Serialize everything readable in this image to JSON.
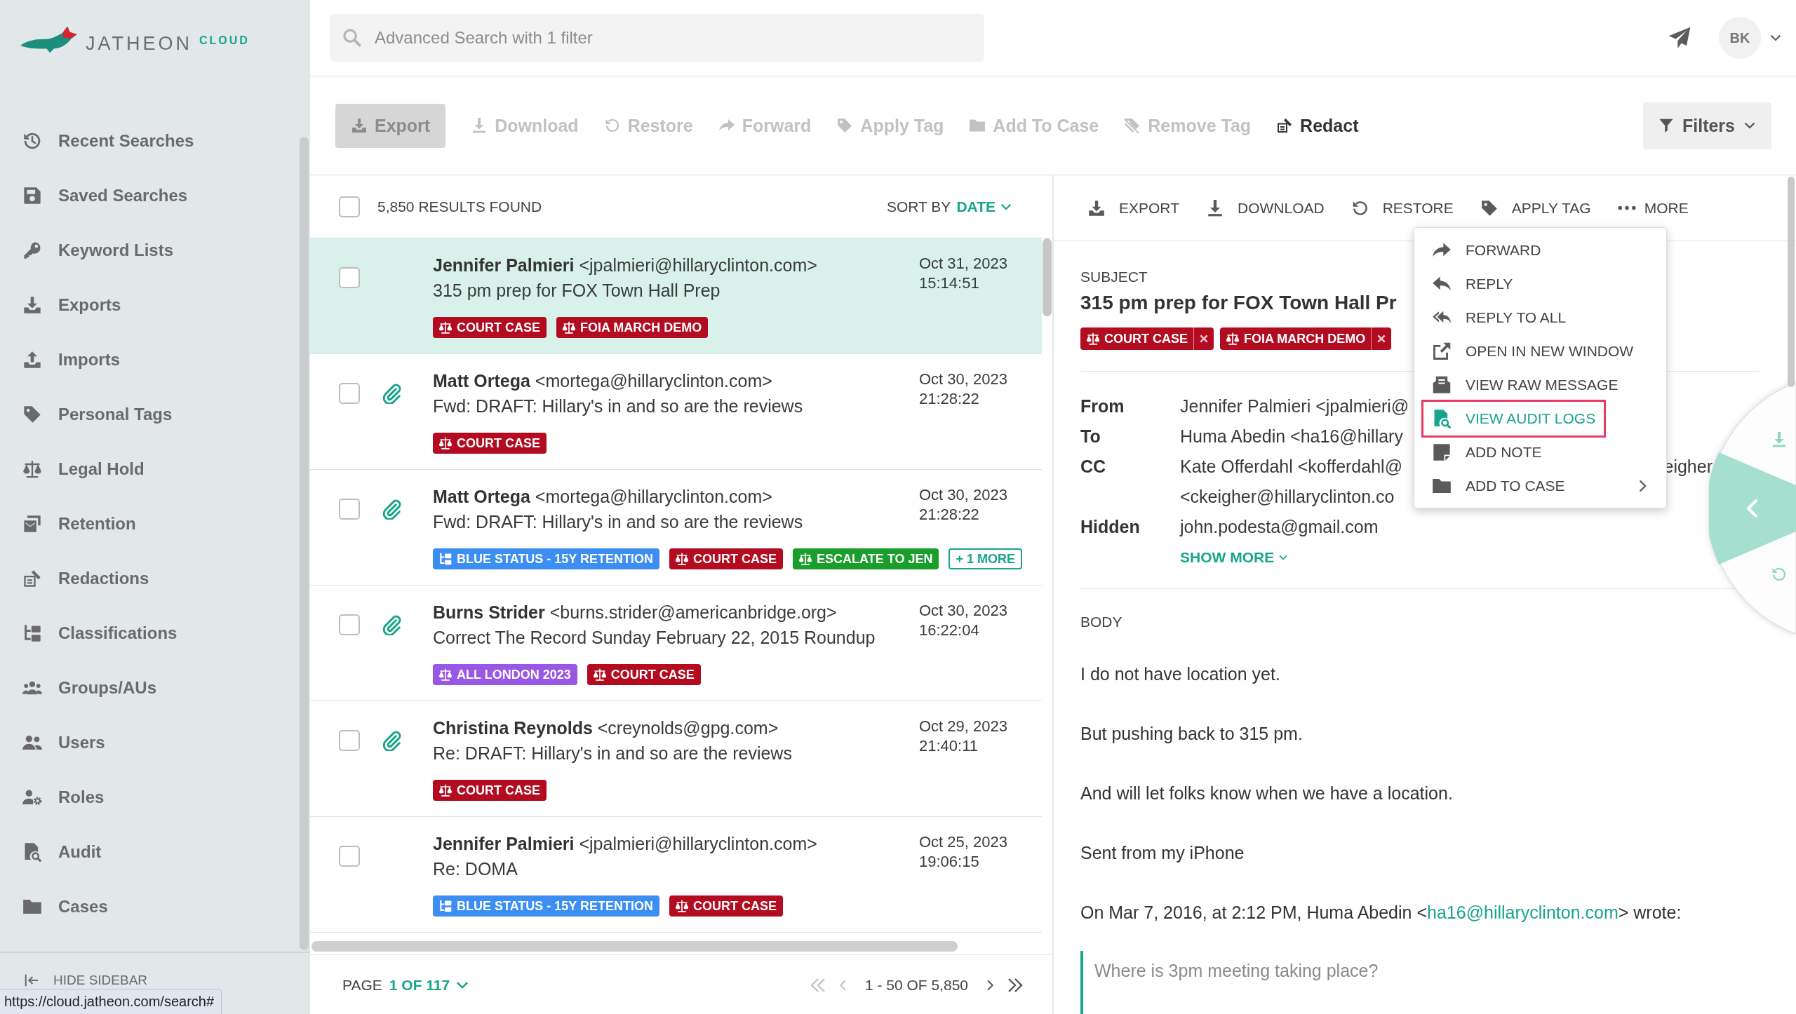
{
  "logo": {
    "name": "JATHEON",
    "suffix": "CLOUD"
  },
  "sidebar": {
    "items": [
      {
        "label": "Recent Searches"
      },
      {
        "label": "Saved Searches"
      },
      {
        "label": "Keyword Lists"
      },
      {
        "label": "Exports"
      },
      {
        "label": "Imports"
      },
      {
        "label": "Personal Tags"
      },
      {
        "label": "Legal Hold"
      },
      {
        "label": "Retention"
      },
      {
        "label": "Redactions"
      },
      {
        "label": "Classifications"
      },
      {
        "label": "Groups/AUs"
      },
      {
        "label": "Users"
      },
      {
        "label": "Roles"
      },
      {
        "label": "Audit"
      },
      {
        "label": "Cases"
      }
    ],
    "hide_label": "HIDE SIDEBAR"
  },
  "header": {
    "search": {
      "placeholder": "Advanced Search with 1 filter"
    },
    "avatar": "BK"
  },
  "toolbar": {
    "buttons": [
      {
        "label": "Export",
        "kind": "primary",
        "disabled": true
      },
      {
        "label": "Download",
        "kind": "plain",
        "disabled": true
      },
      {
        "label": "Restore",
        "kind": "plain",
        "disabled": true
      },
      {
        "label": "Forward",
        "kind": "plain",
        "disabled": true
      },
      {
        "label": "Apply Tag",
        "kind": "plain",
        "disabled": true
      },
      {
        "label": "Add To Case",
        "kind": "plain",
        "disabled": true
      },
      {
        "label": "Remove Tag",
        "kind": "plain",
        "disabled": true
      },
      {
        "label": "Redact",
        "kind": "plain",
        "disabled": false
      }
    ],
    "filters": "Filters"
  },
  "results": {
    "select_all_checked": false,
    "count": "5,850 RESULTS FOUND",
    "sort_label": "SORT BY",
    "sort_value": "DATE",
    "rows": [
      {
        "selected": true,
        "checked": false,
        "attachment": false,
        "sender": "**Jennifer Palmieri** <jpalmieri@hillaryclinton.com>",
        "subject": "315 pm prep for FOX Town Hall Prep",
        "date": "Oct 31, 2023",
        "time": "15:14:51",
        "tags": [
          {
            "label": "COURT CASE",
            "kind": "hold",
            "color": "#b30b1f"
          },
          {
            "label": "FOIA MARCH DEMO",
            "kind": "hold",
            "color": "#b30b1f"
          }
        ]
      },
      {
        "selected": false,
        "checked": false,
        "attachment": true,
        "sender": "**Matt Ortega** <mortega@hillaryclinton.com>",
        "subject": "Fwd: DRAFT: Hillary's in and so are the reviews",
        "date": "Oct 30, 2023",
        "time": "21:28:22",
        "tags": [
          {
            "label": "COURT CASE",
            "kind": "hold",
            "color": "#b30b1f"
          }
        ]
      },
      {
        "selected": false,
        "checked": false,
        "attachment": true,
        "sender": "**Matt Ortega** <mortega@hillaryclinton.com>",
        "subject": "Fwd: DRAFT: Hillary's in and so are the reviews",
        "date": "Oct 30, 2023",
        "time": "21:28:22",
        "tags": [
          {
            "label": "BLUE STATUS - 15Y RETENTION",
            "kind": "classification",
            "color": "#3d8ef2"
          },
          {
            "label": "COURT CASE",
            "kind": "hold",
            "color": "#b30b1f"
          },
          {
            "label": "ESCALATE TO JEN",
            "kind": "hold",
            "color": "#1a9e2b"
          },
          {
            "label": "+ 1 MORE",
            "kind": "more"
          }
        ]
      },
      {
        "selected": false,
        "checked": false,
        "attachment": true,
        "sender": "**Burns Strider** <burns.strider@americanbridge.org>",
        "subject": "Correct The Record Sunday February 22, 2015 Roundup",
        "date": "Oct 30, 2023",
        "time": "16:22:04",
        "tags": [
          {
            "label": "ALL LONDON 2023",
            "kind": "hold",
            "color": "#9957e6"
          },
          {
            "label": "COURT CASE",
            "kind": "hold",
            "color": "#b30b1f"
          }
        ]
      },
      {
        "selected": false,
        "checked": false,
        "attachment": true,
        "sender": "**Christina Reynolds** <creynolds@gpg.com>",
        "subject": "Re: DRAFT: Hillary's in and so are the reviews",
        "date": "Oct 29, 2023",
        "time": "21:40:11",
        "tags": [
          {
            "label": "COURT CASE",
            "kind": "hold",
            "color": "#b30b1f"
          }
        ]
      },
      {
        "selected": false,
        "checked": false,
        "attachment": false,
        "sender": "**Jennifer Palmieri** <jpalmieri@hillaryclinton.com>",
        "subject": "Re: DOMA",
        "date": "Oct 25, 2023",
        "time": "19:06:15",
        "tags": [
          {
            "label": "BLUE STATUS - 15Y RETENTION",
            "kind": "classification",
            "color": "#3d8ef2"
          },
          {
            "label": "COURT CASE",
            "kind": "hold",
            "color": "#b30b1f"
          }
        ]
      }
    ],
    "pagination": {
      "page_label": "PAGE",
      "page": "1 OF 117",
      "range": "1 - 50 OF 5,850",
      "buttons": [
        {
          "disabled": true
        },
        {
          "disabled": true
        },
        {
          "disabled": false
        },
        {
          "disabled": false
        }
      ]
    }
  },
  "detail": {
    "actions": [
      "EXPORT",
      "DOWNLOAD",
      "RESTORE",
      "APPLY TAG",
      "MORE"
    ],
    "subject_label": "SUBJECT",
    "subject": "315 pm prep for FOX Town Hall Pr",
    "tags": [
      {
        "label": "COURT CASE",
        "kind": "hold",
        "color": "#b30b1f"
      },
      {
        "label": "FOIA MARCH DEMO",
        "kind": "hold",
        "color": "#b30b1f"
      }
    ],
    "fields": [
      {
        "label": "From",
        "lines": [
          [
            "Jennifer Palmieri <jpalmieri@"
          ]
        ]
      },
      {
        "label": "To",
        "lines": [
          [
            "Huma Abedin <ha16@hillary"
          ]
        ]
      },
      {
        "label": "CC",
        "lines": [
          [
            "Kate Offerdahl <kofferdahl@",
            "eigher"
          ],
          [
            "<ckeigher@hillaryclinton.co"
          ]
        ]
      },
      {
        "label": "Hidden",
        "lines": [
          [
            "john.podesta@gmail.com"
          ]
        ]
      }
    ],
    "show_more": "SHOW MORE",
    "body_label": "BODY",
    "paragraphs": [
      {
        "text": "I do not have location yet."
      },
      {
        "text": "But pushing back to 315 pm."
      },
      {
        "text": "And will let folks know when we have a location."
      },
      {
        "text": "Sent from my iPhone"
      },
      {
        "text": "On Mar 7, 2016, at 2:12 PM, Huma Abedin <",
        "link": "ha16@hillaryclinton.com",
        "after": "> wrote:"
      }
    ],
    "quote": "Where is 3pm meeting taking place?"
  },
  "more_menu": {
    "items": [
      {
        "label": "FORWARD",
        "selected": false,
        "submenu": false
      },
      {
        "label": "REPLY",
        "selected": false,
        "submenu": false
      },
      {
        "label": "REPLY TO ALL",
        "selected": false,
        "submenu": false
      },
      {
        "label": "OPEN IN NEW WINDOW",
        "selected": false,
        "submenu": false
      },
      {
        "label": "VIEW RAW MESSAGE",
        "selected": false,
        "submenu": false
      },
      {
        "label": "VIEW AUDIT LOGS",
        "selected": true,
        "submenu": false
      },
      {
        "label": "ADD NOTE",
        "selected": false,
        "submenu": false
      },
      {
        "label": "ADD TO CASE",
        "selected": false,
        "submenu": true
      }
    ]
  },
  "status_bar": {
    "url": "https://cloud.jatheon.com/search#"
  }
}
